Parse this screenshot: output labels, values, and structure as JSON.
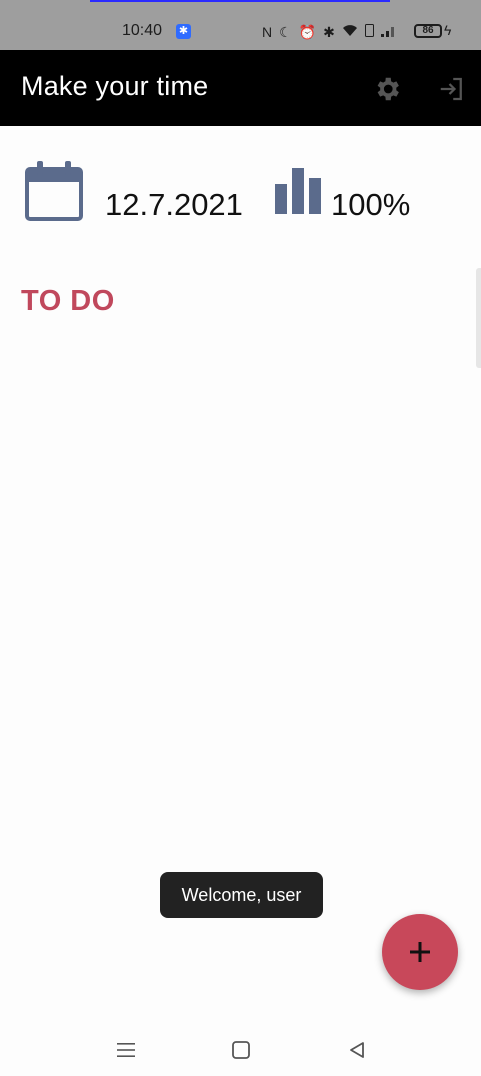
{
  "status_bar": {
    "time": "10:40",
    "bluetooth_badge_icon": "bluetooth-icon",
    "icons": [
      "nfc-icon",
      "do-not-disturb-icon",
      "alarm-icon",
      "bluetooth-icon",
      "wifi-icon",
      "sim-icon",
      "signal-icon"
    ],
    "battery_level": "86",
    "charging_icon": "bolt-icon"
  },
  "app_bar": {
    "title": "Make your time",
    "settings_icon": "gear-icon",
    "logout_icon": "logout-icon",
    "background": "#000000"
  },
  "summary": {
    "date": "12.7.2021",
    "percent": "100%",
    "calendar_icon": "calendar-icon",
    "stats_icon": "bar-chart-icon",
    "icon_color": "#5b6b8c"
  },
  "section": {
    "title": "TO DO",
    "color": "#c0485c"
  },
  "toast": {
    "message": "Welcome, user"
  },
  "fab": {
    "label": "+",
    "color": "#c8485a"
  },
  "nav_bar": {
    "icons": [
      "menu-icon",
      "home-icon",
      "back-icon"
    ]
  }
}
